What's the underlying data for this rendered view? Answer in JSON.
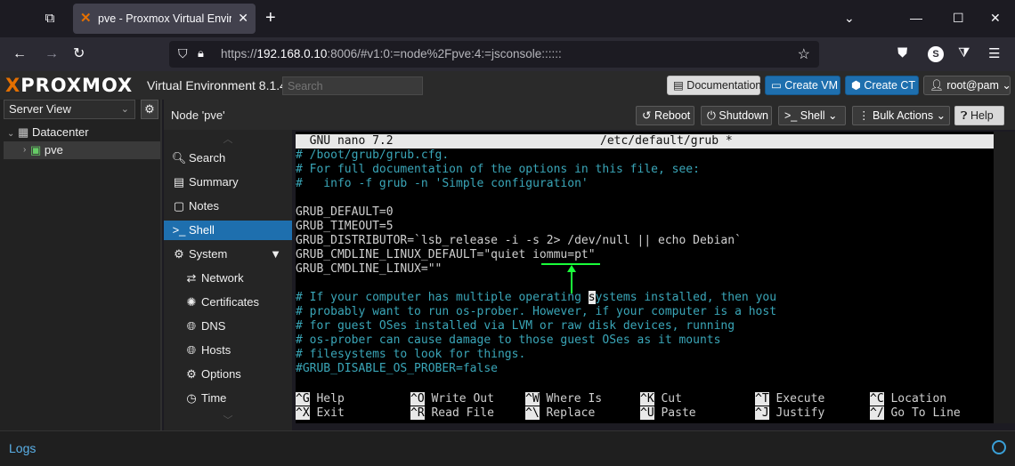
{
  "browser": {
    "tab_title": "pve - Proxmox Virtual Environment",
    "url_prefix": "https://",
    "url_host": "192.168.0.10",
    "url_rest": ":8006/#v1:0:=node%2Fpve:4:=jsconsole::::::",
    "icons": [
      "tab-list-icon",
      "proxmox-favicon",
      "close-icon",
      "plus-icon",
      "chevron-down-icon",
      "minimize-icon",
      "maximize-icon",
      "close-window-icon",
      "back-arrow-icon",
      "forward-arrow-icon",
      "reload-icon",
      "shield-icon",
      "lock-icon",
      "star-icon",
      "pocket-icon",
      "extensions-icon",
      "menu-icon"
    ]
  },
  "header": {
    "logo": "PROXMOX",
    "product": "Virtual Environment 8.1.4",
    "search_placeholder": "Search",
    "documentation": "Documentation",
    "create_vm": "Create VM",
    "create_ct": "Create CT",
    "user": "root@pam"
  },
  "tree": {
    "view": "Server View",
    "datacenter": "Datacenter",
    "node": "pve"
  },
  "nodebar": {
    "title": "Node 'pve'",
    "reboot": "Reboot",
    "shutdown": "Shutdown",
    "shell": "Shell",
    "bulk": "Bulk Actions",
    "help": "Help"
  },
  "menu": {
    "items": [
      {
        "label": "Search",
        "icon": "search-icon"
      },
      {
        "label": "Summary",
        "icon": "book-icon"
      },
      {
        "label": "Notes",
        "icon": "notes-icon"
      },
      {
        "label": "Shell",
        "icon": "terminal-icon"
      },
      {
        "label": "System",
        "icon": "cogs-icon"
      },
      {
        "label": "Network",
        "icon": "exchange-icon"
      },
      {
        "label": "Certificates",
        "icon": "certificate-icon"
      },
      {
        "label": "DNS",
        "icon": "globe-icon"
      },
      {
        "label": "Hosts",
        "icon": "globe-icon"
      },
      {
        "label": "Options",
        "icon": "gear-icon"
      },
      {
        "label": "Time",
        "icon": "clock-icon"
      }
    ]
  },
  "terminal": {
    "title_left": "  GNU nano 7.2",
    "title_right": "/etc/default/grub *",
    "lines": [
      "# /boot/grub/grub.cfg.",
      "# For full documentation of the options in this file, see:",
      "#   info -f grub -n 'Simple configuration'",
      "",
      "GRUB_DEFAULT=0",
      "GRUB_TIMEOUT=5",
      "GRUB_DISTRIBUTOR=`lsb_release -i -s 2> /dev/null || echo Debian`",
      "GRUB_CMDLINE_LINUX_DEFAULT=\"quiet iommu=pt\"",
      "GRUB_CMDLINE_LINUX=\"\"",
      "",
      "# If your computer has multiple operating ",
      "# probably want to run os-prober. However, if your computer is a host",
      "# for guest OSes installed via LVM or raw disk devices, running",
      "# os-prober can cause damage to those guest OSes as it mounts",
      "# filesystems to look for things.",
      "#GRUB_DISABLE_OS_PROBER=false"
    ],
    "cursor_char": "s",
    "cursor_rest": "ystems installed, then you",
    "shortcuts_row1": [
      {
        "key": "^G",
        "label": "Help"
      },
      {
        "key": "^O",
        "label": "Write Out"
      },
      {
        "key": "^W",
        "label": "Where Is"
      },
      {
        "key": "^K",
        "label": "Cut"
      },
      {
        "key": "^T",
        "label": "Execute"
      },
      {
        "key": "^C",
        "label": "Location"
      }
    ],
    "shortcuts_row2": [
      {
        "key": "^X",
        "label": "Exit"
      },
      {
        "key": "^R",
        "label": "Read File"
      },
      {
        "key": "^\\",
        "label": "Replace"
      },
      {
        "key": "^U",
        "label": "Paste"
      },
      {
        "key": "^J",
        "label": "Justify"
      },
      {
        "key": "^/",
        "label": "Go To Line"
      }
    ]
  },
  "logs": {
    "title": "Logs"
  }
}
